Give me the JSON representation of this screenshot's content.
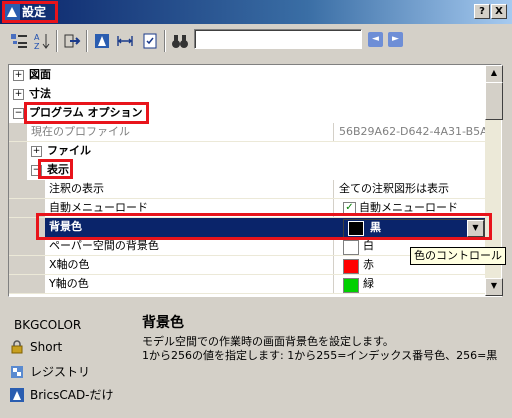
{
  "window": {
    "title": "設定",
    "help_btn": "?",
    "close_btn": "X"
  },
  "toolbar": {
    "icons": [
      "categorized-view-icon",
      "alphabetical-view-icon",
      "export-icon",
      "bricscad-icon",
      "dimension-icon",
      "checklist-icon",
      "binoculars-icon"
    ],
    "search_value": "",
    "prev_btn": "◄",
    "next_btn": "►"
  },
  "grid": {
    "rows": {
      "zumen": "図面",
      "sunpo": "寸法",
      "program_options": "プログラム オプション",
      "current_profile_label": "現在のプロファイル",
      "current_profile_value": "56B29A62-D642-4A31-B5A",
      "file": "ファイル",
      "display": "表示",
      "annotation_label": "注釈の表示",
      "annotation_value": "全ての注釈図形は表示",
      "auto_menu_label": "自動メニューロード",
      "auto_menu_value": "自動メニューロード",
      "bkg_label": "背景色",
      "bkg_value": "黒",
      "paper_bkg_label": "ペーパー空間の背景色",
      "paper_bkg_value": "白",
      "x_axis_label": "X軸の色",
      "x_axis_value": "赤",
      "y_axis_label": "Y軸の色",
      "y_axis_value": "緑"
    },
    "colors": {
      "black": "#000000",
      "white": "#ffffff",
      "red": "#ff0000",
      "green": "#00d000",
      "selection": "#0a246a"
    },
    "tooltip": "色のコントロール"
  },
  "info": {
    "var_name": "BKGCOLOR",
    "title": "背景色",
    "desc_line1": "モデル空間での作業時の画面背景色を設定します。",
    "desc_line2": "1から256の値を指定します: 1から255=インデックス番号色、256=黒",
    "short": "Short",
    "registry": "レジストリ",
    "bricscad_only": "BricsCAD-だけ"
  },
  "accent": "#e8141b"
}
